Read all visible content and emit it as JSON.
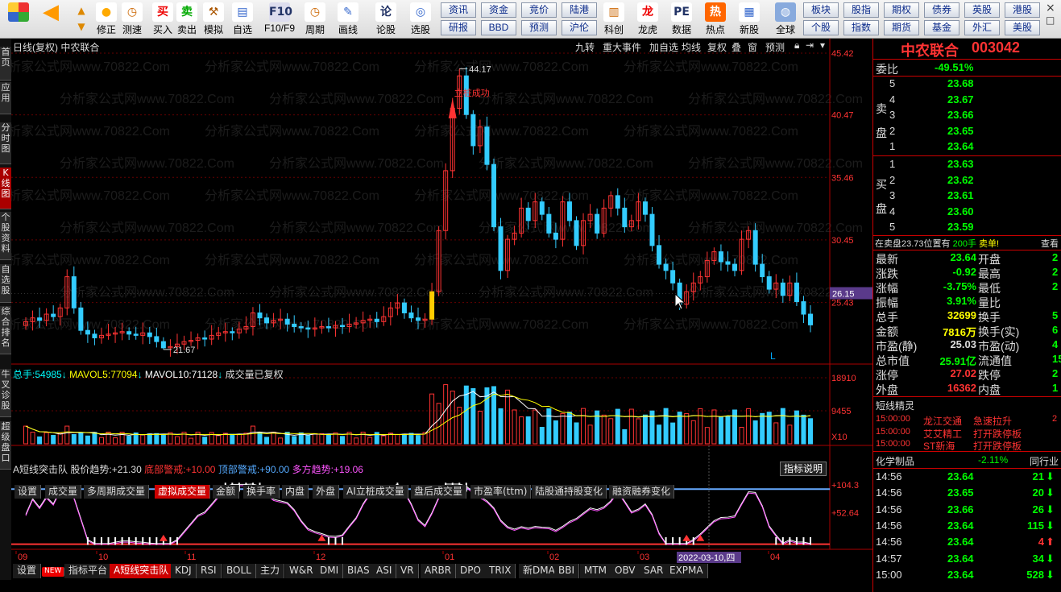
{
  "toolbar": {
    "buttons": [
      {
        "label": "修正",
        "icon": "blank"
      },
      {
        "label": "测速",
        "icon": "clock"
      },
      {
        "label": "买入",
        "icon": "买"
      },
      {
        "label": "卖出",
        "icon": "卖"
      },
      {
        "label": "模拟",
        "icon": "hammer"
      },
      {
        "label": "自选",
        "icon": "folder"
      },
      {
        "label": "F10/F9",
        "icon": "F10"
      },
      {
        "label": "周期",
        "icon": "clock"
      },
      {
        "label": "画线",
        "icon": "pencil"
      },
      {
        "label": "论股",
        "icon": "论"
      },
      {
        "label": "选股",
        "icon": "choose"
      },
      {
        "label": "科创",
        "icon": "chart"
      },
      {
        "label": "龙虎",
        "icon": "dragon"
      },
      {
        "label": "数据",
        "icon": "PE"
      },
      {
        "label": "热点",
        "icon": "HOT"
      },
      {
        "label": "新股",
        "icon": "new"
      },
      {
        "label": "全球",
        "icon": "globe"
      }
    ],
    "quick": [
      [
        "资讯",
        "资金",
        "竞价",
        "陆港"
      ],
      [
        "研报",
        "BBD",
        "预测",
        "沪伦"
      ],
      [
        "板块",
        "股指",
        "期权",
        "债券",
        "英股",
        "港股"
      ],
      [
        "个股",
        "指数",
        "期货",
        "基金",
        "外汇",
        "美股"
      ]
    ]
  },
  "sidebar": [
    "首页",
    "应用",
    "分时图",
    "K线图",
    "个股资料",
    "自选股",
    "综合排名",
    "牛叉诊股",
    "超级盘口"
  ],
  "chart": {
    "title": "日线(复权)  中农联合",
    "buttons": [
      "九转",
      "重大事件",
      "加自选",
      "均线",
      "复权",
      "叠",
      "窗",
      "预测"
    ],
    "price_axis": [
      "45.42",
      "40.47",
      "35.46",
      "30.45",
      "25.43"
    ],
    "current_price_tag": "26.15",
    "high_label": "44.17",
    "low_label": "21.67",
    "signal_label": "立桩成功",
    "l_marker": "L",
    "volume_header": {
      "total_label": "总手:",
      "total": "54985",
      "mavol5_label": "MAVOL5:",
      "mavol5": "77094",
      "mavol10_label": "MAVOL10:",
      "mavol10": "71128",
      "note": "成交量已复权"
    },
    "volume_axis": [
      "18910",
      "9455",
      "X10"
    ],
    "tabs": [
      "设置",
      "成交量",
      "多周期成交量",
      "虚拟成交量",
      "金额",
      "换手率",
      "内盘",
      "外盘",
      "AI立桩成交量",
      "盘后成交量",
      "市盈率(ttm)",
      "陆股通持股变化",
      "融资融券变化"
    ],
    "active_tab": "虚拟成交量",
    "indicator_header": {
      "name": "A短线突击队",
      "trend_label": "股价趋势:",
      "trend": "+21.30",
      "bottom_label": "底部警戒:",
      "bottom": "+10.00",
      "top_label": "顶部警戒:",
      "top": "+90.00",
      "bull_label": "多方趋势:",
      "bull": "+19.06"
    },
    "indicator_button": "指标说明",
    "indicator_axis": [
      "+104.3",
      "+52.64"
    ],
    "months": [
      "09",
      "10",
      "11",
      "12",
      "01",
      "02",
      "03",
      "04"
    ],
    "date_tag": "2022-03-10,四",
    "bottom_tabs": [
      "设置",
      "NEW",
      "指标平台",
      "A短线突击队",
      "KDJ",
      "RSI",
      "BOLL",
      "主力",
      "W&R",
      "DMI",
      "BIAS",
      "ASI",
      "VR",
      "ARBR",
      "DPO",
      "TRIX",
      "新DMA",
      "BBI",
      "MTM",
      "OBV",
      "SAR",
      "EXPMA"
    ],
    "active_bottom_tab": "A短线突击队",
    "watermark": "分析家公式网www.70822.Com"
  },
  "quote": {
    "name": "中农联合",
    "code": "003042",
    "weibi_label": "委比",
    "weibi": "-49.51%",
    "sell_label": [
      "卖",
      "盘"
    ],
    "buy_label": [
      "买",
      "盘"
    ],
    "sell": [
      {
        "lvl": "5",
        "price": "23.68"
      },
      {
        "lvl": "4",
        "price": "23.67"
      },
      {
        "lvl": "3",
        "price": "23.66"
      },
      {
        "lvl": "2",
        "price": "23.65"
      },
      {
        "lvl": "1",
        "price": "23.64"
      }
    ],
    "buy": [
      {
        "lvl": "1",
        "price": "23.63"
      },
      {
        "lvl": "2",
        "price": "23.62"
      },
      {
        "lvl": "3",
        "price": "23.61"
      },
      {
        "lvl": "4",
        "price": "23.60"
      },
      {
        "lvl": "5",
        "price": "23.59"
      }
    ],
    "position_note": "在卖盘23.73位置有",
    "position_qty": "200手",
    "position_tail": "卖单!",
    "position_action": "查看",
    "stats": [
      {
        "l": "最新",
        "v": "23.64",
        "l2": "开盘",
        "v2": "2"
      },
      {
        "l": "涨跌",
        "v": "-0.92",
        "l2": "最高",
        "v2": "2"
      },
      {
        "l": "涨幅",
        "v": "-3.75%",
        "l2": "最低",
        "v2": "2"
      },
      {
        "l": "振幅",
        "v": "3.91%",
        "l2": "量比",
        "v2": ""
      },
      {
        "l": "总手",
        "v": "32699",
        "l2": "换手",
        "v2": "5"
      },
      {
        "l": "金额",
        "v": "7816万",
        "l2": "换手(实)",
        "v2": "6"
      },
      {
        "l": "市盈(静)",
        "v": "25.03",
        "l2": "市盈(动)",
        "v2": "4"
      },
      {
        "l": "总市值",
        "v": "25.91亿",
        "l2": "流通值",
        "v2": "15."
      },
      {
        "l": "涨停",
        "v": "27.02",
        "l2": "跌停",
        "v2": "2"
      },
      {
        "l": "外盘",
        "v": "16362",
        "l2": "内盘",
        "v2": "1"
      }
    ],
    "sprite_title": "短线精灵",
    "sprite": [
      {
        "t": "15:00:00",
        "n": "龙江交通",
        "e": "急速拉升",
        "x": "2"
      },
      {
        "t": "15:00:00",
        "n": "艾艾精工",
        "e": "打开跌停板",
        "x": ""
      },
      {
        "t": "15:00:00",
        "n": "ST新海",
        "e": "打开跌停板",
        "x": ""
      }
    ],
    "industry": "化学制品",
    "industry_change": "-2.11%",
    "industry_link": "同行业",
    "ticks": [
      {
        "t": "14:56",
        "p": "23.64",
        "v": "21",
        "d": "down"
      },
      {
        "t": "14:56",
        "p": "23.65",
        "v": "20",
        "d": "down"
      },
      {
        "t": "14:56",
        "p": "23.66",
        "v": "26",
        "d": "down"
      },
      {
        "t": "14:56",
        "p": "23.64",
        "v": "115",
        "d": "down"
      },
      {
        "t": "14:56",
        "p": "23.64",
        "v": "4",
        "d": "up"
      },
      {
        "t": "14:57",
        "p": "23.64",
        "v": "34",
        "d": "down"
      },
      {
        "t": "15:00",
        "p": "23.64",
        "v": "528",
        "d": "down"
      }
    ]
  },
  "chart_data": {
    "type": "candlestick",
    "title": "日线(复权)  中农联合",
    "ylim": [
      20.5,
      45.42
    ],
    "high": 44.17,
    "low": 21.67,
    "closes": [
      23.9,
      24.2,
      24.0,
      24.5,
      24.3,
      25.0,
      27.5,
      25.0,
      23.2,
      22.9,
      22.6,
      22.8,
      22.9,
      23.0,
      23.1,
      22.9,
      22.8,
      23.0,
      22.7,
      22.3,
      21.8,
      21.9,
      22.1,
      22.3,
      22.4,
      22.6,
      22.5,
      22.8,
      23.0,
      23.1,
      23.0,
      23.3,
      23.5,
      24.6,
      24.2,
      23.8,
      24.0,
      24.1,
      23.7,
      23.5,
      23.4,
      23.3,
      23.4,
      23.5,
      23.4,
      23.6,
      23.5,
      23.7,
      23.8,
      24.0,
      24.1,
      23.9,
      24.3,
      25.0,
      25.4,
      24.6,
      24.2,
      24.0,
      24.1,
      26.3,
      31.2,
      36.0,
      41.0,
      43.6,
      40.5,
      38.0,
      39.5,
      36.5,
      31.5,
      28.0,
      30.5,
      31.0,
      33.0,
      32.0,
      33.5,
      32.5,
      31.0,
      30.5,
      33.5,
      32.0,
      30.0,
      32.0,
      32.5,
      31.0,
      33.0,
      34.0,
      33.0,
      31.5,
      32.0,
      33.5,
      32.5,
      30.0,
      28.5,
      28.0,
      27.0,
      25.3,
      26.3,
      27.0,
      27.5,
      28.8,
      29.5,
      28.7,
      28.5,
      28.0,
      30.5,
      31.2,
      28.5,
      27.5,
      26.5,
      27.0,
      26.0,
      27.0,
      25.5,
      24.5,
      23.64
    ],
    "volume": {
      "ylim": [
        0,
        18910
      ],
      "mavol5": 77094,
      "mavol10": 71128,
      "total": 54985
    },
    "indicator": {
      "ylim": [
        0,
        104.3
      ],
      "top": 90.0,
      "bottom": 10.0,
      "trend": 21.3,
      "bull": 19.06
    }
  }
}
